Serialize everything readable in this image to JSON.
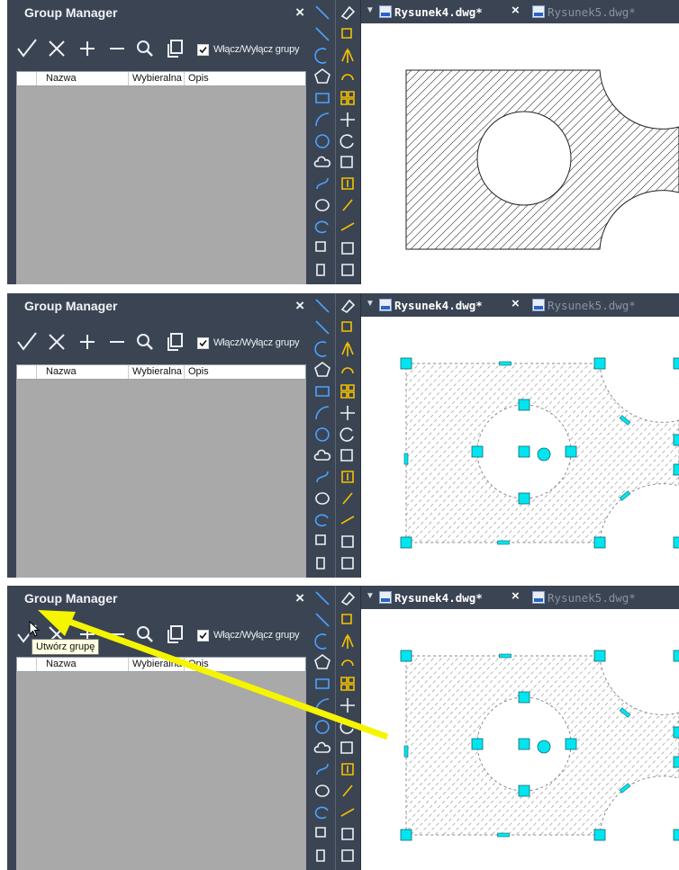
{
  "panel": {
    "title": "Group Manager",
    "close": "×",
    "toggle_groups_label": "Włącz/Wyłącz grupy",
    "columns": [
      "Nazwa",
      "Wybieralna",
      "Opis"
    ]
  },
  "tabs": [
    {
      "label": "Rysunek4.dwg*",
      "active": true
    },
    {
      "label": "Rysunek5.dwg*",
      "active": false
    }
  ],
  "tab_close": "×",
  "tooltip": "Utwórz grupę",
  "colors": {
    "panel_bg": "#3b4453",
    "grid_body": "#a9a9a9",
    "grip": "#00e5f0",
    "annotation_arrow": "#f5f500"
  },
  "steps": [
    {
      "selected": false,
      "tooltip": false,
      "arrow": false
    },
    {
      "selected": true,
      "tooltip": false,
      "arrow": false
    },
    {
      "selected": true,
      "tooltip": true,
      "arrow": true
    }
  ]
}
